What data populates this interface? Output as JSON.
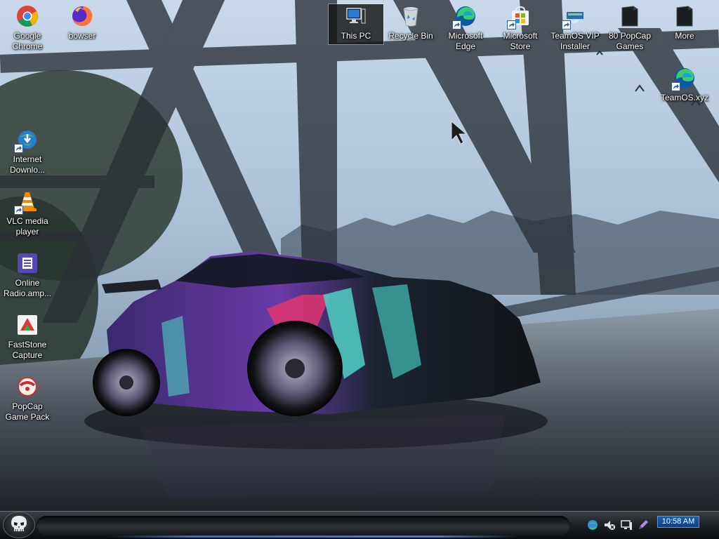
{
  "desktop": {
    "top_icons": [
      {
        "name": "google-chrome-icon",
        "label": "Google Chrome"
      },
      {
        "name": "bowser-icon",
        "label": "bowser"
      },
      {
        "name": "this-pc-icon",
        "label": "This PC"
      },
      {
        "name": "recycle-bin-icon",
        "label": "Recycle Bin"
      },
      {
        "name": "microsoft-edge-icon",
        "label": "Microsoft Edge"
      },
      {
        "name": "microsoft-store-icon",
        "label": "Microsoft Store"
      },
      {
        "name": "teamos-vip-installer-icon",
        "label": "TeamOS VIP Installer"
      },
      {
        "name": "popcap-games-icon",
        "label": "80 PopCap Games"
      },
      {
        "name": "more-folder-icon",
        "label": "More"
      }
    ],
    "right_icons": [
      {
        "name": "teamos-xyz-icon",
        "label": "TeamOS.xyz"
      }
    ],
    "left_icons": [
      {
        "name": "internet-download-manager-icon",
        "label": "Internet Downlo..."
      },
      {
        "name": "vlc-media-player-icon",
        "label": "VLC media player"
      },
      {
        "name": "online-radio-icon",
        "label": "Online Radio.amp..."
      },
      {
        "name": "faststone-capture-icon",
        "label": "FastStone Capture"
      },
      {
        "name": "popcap-game-pack-icon",
        "label": "PopCap Game Pack"
      }
    ],
    "selected_icon": "This PC"
  },
  "taskbar": {
    "start_icon": "skull-start-icon",
    "tray_icons": [
      "network-globe-icon",
      "volume-muted-icon",
      "display-icon",
      "pen-icon"
    ],
    "clock": "10:58 AM"
  },
  "colors": {
    "clock_bg": "#1e5fb0",
    "selection_bg": "#1a1a1a",
    "taskbar_glow": "#3c7fd9"
  }
}
